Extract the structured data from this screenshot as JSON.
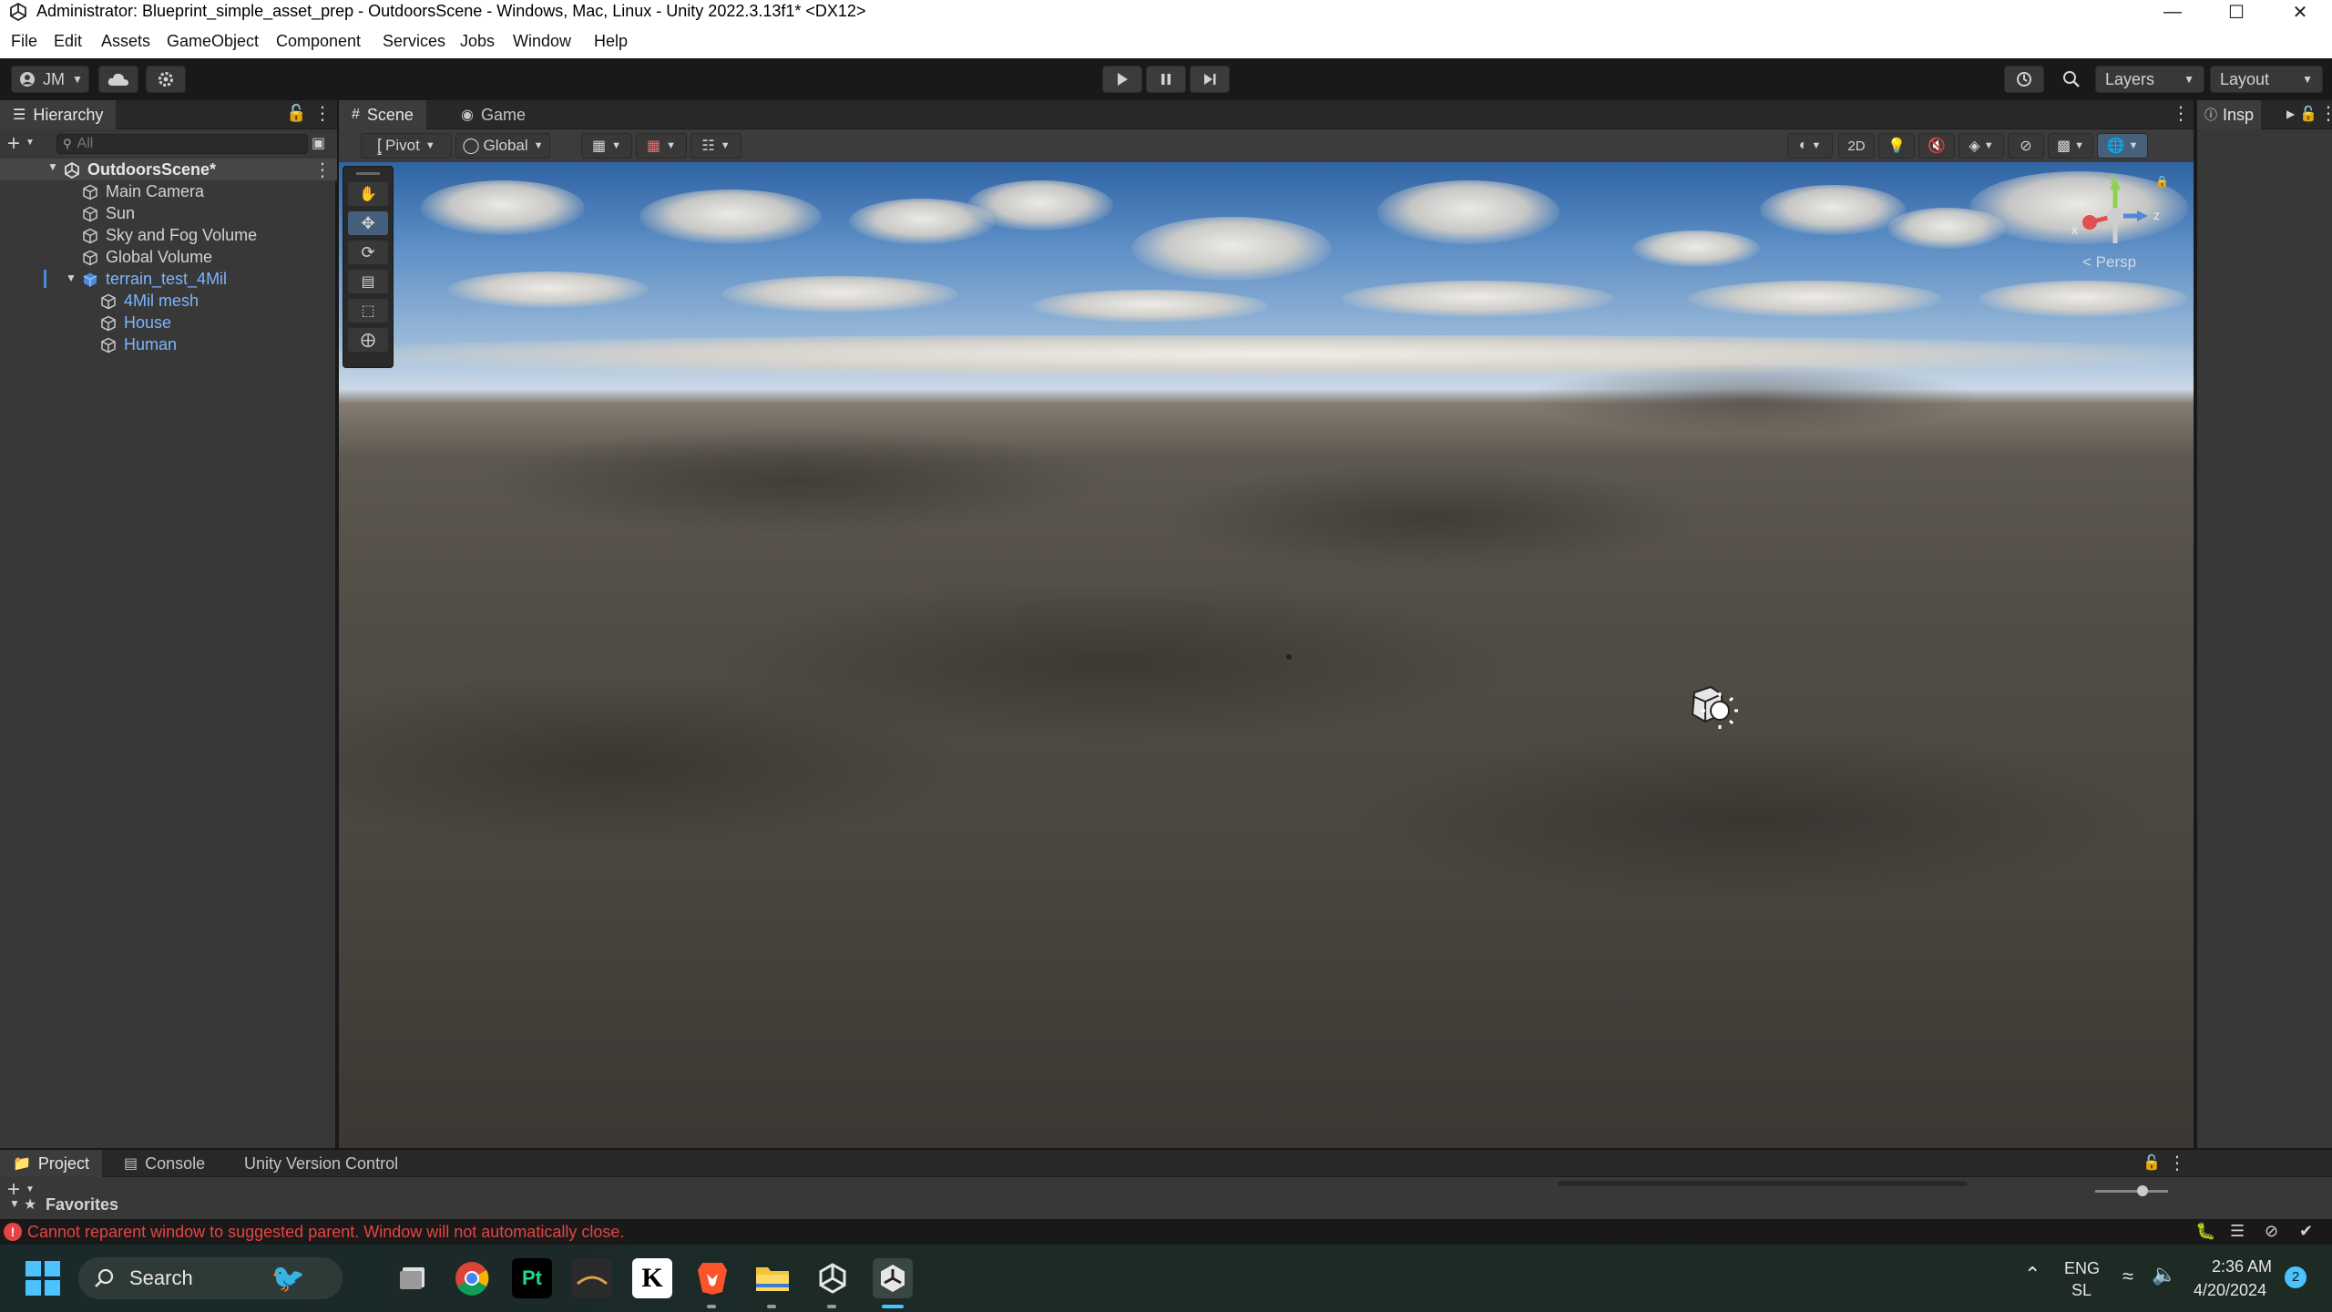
{
  "window": {
    "title": "Administrator: Blueprint_simple_asset_prep - OutdoorsScene - Windows, Mac, Linux - Unity 2022.3.13f1* <DX12>"
  },
  "menu": [
    "File",
    "Edit",
    "Assets",
    "GameObject",
    "Component",
    "Services",
    "Jobs",
    "Window",
    "Help"
  ],
  "toolbar": {
    "account": "JM",
    "layers_label": "Layers",
    "layout_label": "Layout"
  },
  "hierarchy": {
    "tab": "Hierarchy",
    "search_placeholder": "All",
    "scene_name": "OutdoorsScene*",
    "items": [
      {
        "label": "Main Camera"
      },
      {
        "label": "Sun"
      },
      {
        "label": "Sky and Fog Volume"
      },
      {
        "label": "Global Volume"
      },
      {
        "label": "terrain_test_4Mil"
      },
      {
        "label": "4Mil mesh"
      },
      {
        "label": "House"
      },
      {
        "label": "Human"
      }
    ]
  },
  "scene": {
    "tabs": [
      "Scene",
      "Game"
    ],
    "pivot_label": "Pivot",
    "global_label": "Global",
    "mode_2d": "2D",
    "persp_label": "< Persp",
    "gizmo_axes": {
      "y": "y",
      "x": "x",
      "z": "z"
    }
  },
  "inspector": {
    "tab": "Insp"
  },
  "bottom": {
    "tabs": [
      "Project",
      "Console",
      "Unity Version Control"
    ],
    "favorites": "Favorites"
  },
  "status": {
    "error_message": "Cannot reparent window to suggested parent. Window will not automatically close.",
    "error_color": "#e64444"
  },
  "taskbar": {
    "search_label": "Search",
    "lang_top": "ENG",
    "lang_bottom": "SL",
    "time": "2:36 AM",
    "date": "4/20/2024",
    "notification_count": "2",
    "apps": [
      "task-view",
      "chrome",
      "pycharm",
      "terminal",
      "k-app",
      "brave",
      "file-explorer",
      "unity-hub",
      "unity"
    ]
  }
}
